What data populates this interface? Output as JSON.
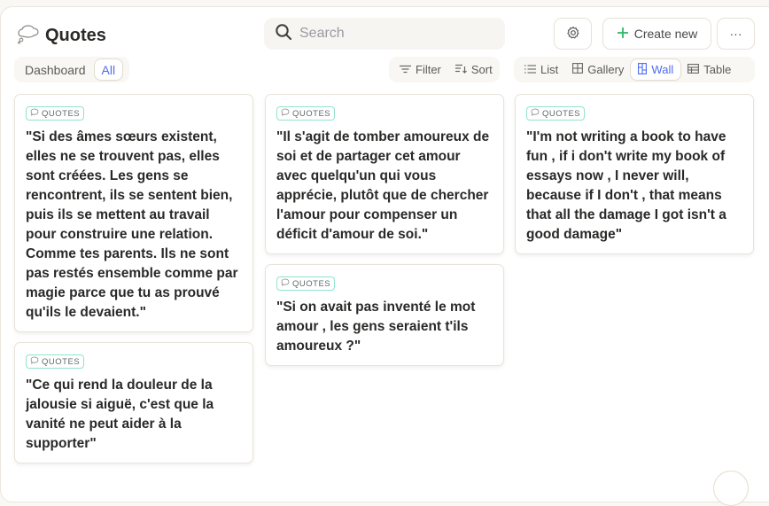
{
  "header": {
    "title": "Quotes",
    "title_icon": "thought-bubble-icon",
    "search_placeholder": "Search",
    "settings_icon": "gear-icon",
    "create_label": "Create new",
    "more_label": "···"
  },
  "views_left": [
    {
      "label": "Dashboard",
      "active": false
    },
    {
      "label": "All",
      "active": true
    }
  ],
  "toolbar": {
    "filter_label": "Filter",
    "sort_label": "Sort"
  },
  "layouts": [
    {
      "label": "List",
      "icon": "list-icon",
      "active": false
    },
    {
      "label": "Gallery",
      "icon": "gallery-icon",
      "active": false
    },
    {
      "label": "Wall",
      "icon": "wall-icon",
      "active": true
    },
    {
      "label": "Table",
      "icon": "table-icon",
      "active": false
    }
  ],
  "accent_color": "#4d6bf0",
  "tag_color": "#8fe3cf",
  "cards": [
    {
      "tag": "QUOTES",
      "text": "\"Si des âmes sœurs existent, elles ne se trouvent pas, elles sont créées. Les gens se rencontrent, ils se sentent bien, puis ils se mettent au travail pour construire une relation. Comme tes parents. Ils ne sont pas restés ensemble comme par magie parce que tu as prouvé qu'ils le devaient.\""
    },
    {
      "tag": "QUOTES",
      "text": "\"Ce qui rend la douleur de la jalousie si aiguë, c'est que la vanité ne peut aider à la supporter\""
    },
    {
      "tag": "QUOTES",
      "text": "\"Il s'agit de tomber amoureux de soi et de partager cet amour avec quelqu'un qui vous apprécie, plutôt que de chercher l'amour pour compenser un déficit d'amour de soi.\""
    },
    {
      "tag": "QUOTES",
      "text": "\"Si on avait pas inventé le mot amour , les gens seraient t'ils amoureux ?\""
    },
    {
      "tag": "QUOTES",
      "text": "\"I'm not writing a book to have fun , if i don't write my book of essays now , I never will, because if I don't , that means that all the damage I got isn't a good damage\""
    }
  ]
}
